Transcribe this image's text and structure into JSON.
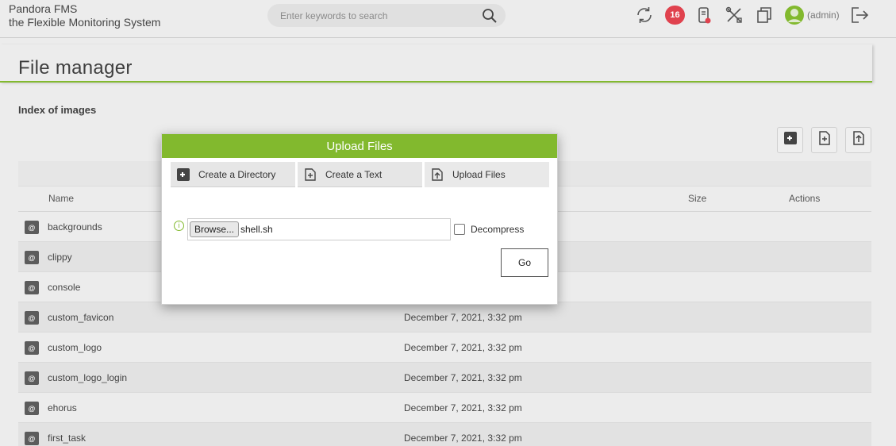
{
  "header": {
    "brand_line1": "Pandora FMS",
    "brand_line2": "the Flexible Monitoring System",
    "search_placeholder": "Enter keywords to search",
    "notification_count": "16",
    "user_label": "(admin)",
    "icons": [
      "refresh-icon",
      "notification-badge",
      "events-icon",
      "tools-icon",
      "copy-icon",
      "user-avatar-icon",
      "logout-icon"
    ],
    "accent_color": "#82b92e",
    "badge_color": "#e0424e"
  },
  "page": {
    "title": "File manager",
    "subtitle": "Index of images"
  },
  "table": {
    "columns": [
      "Name",
      "Size",
      "Actions"
    ],
    "rows": [
      {
        "name": "backgrounds",
        "date": ""
      },
      {
        "name": "clippy",
        "date": ""
      },
      {
        "name": "console",
        "date": ""
      },
      {
        "name": "custom_favicon",
        "date": "December 7, 2021, 3:32 pm"
      },
      {
        "name": "custom_logo",
        "date": "December 7, 2021, 3:32 pm"
      },
      {
        "name": "custom_logo_login",
        "date": "December 7, 2021, 3:32 pm"
      },
      {
        "name": "ehorus",
        "date": "December 7, 2021, 3:32 pm"
      },
      {
        "name": "first_task",
        "date": "December 7, 2021, 3:32 pm"
      }
    ]
  },
  "modal": {
    "title": "Upload Files",
    "tabs": [
      {
        "label": "Create a Directory",
        "icon": "add-folder-icon"
      },
      {
        "label": "Create a Text",
        "icon": "add-file-icon"
      },
      {
        "label": "Upload Files",
        "icon": "upload-icon"
      }
    ],
    "browse_label": "Browse...",
    "file_value": "shell.sh",
    "decompress_label": "Decompress",
    "go_label": "Go"
  }
}
